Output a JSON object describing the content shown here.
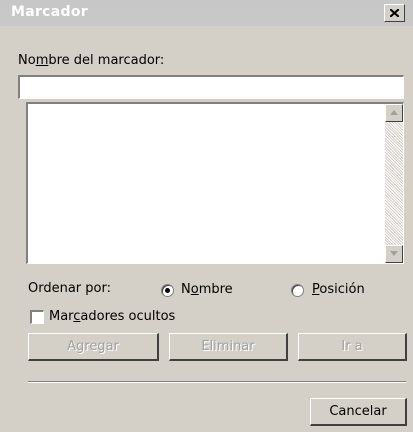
{
  "window": {
    "title": "Marcador"
  },
  "name_field": {
    "label": "Nombre del marcador:",
    "value": ""
  },
  "bookmarks_list": {
    "items": []
  },
  "sort": {
    "label": "Ordenar por:",
    "options": [
      {
        "label": "Nombre",
        "selected": true
      },
      {
        "label": "Posición",
        "selected": false
      }
    ]
  },
  "hidden_bookmarks": {
    "label": "Marcadores ocultos",
    "checked": false
  },
  "buttons": {
    "add": "Agregar",
    "delete": "Eliminar",
    "goto": "Ir a",
    "cancel": "Cancelar"
  },
  "colors": {
    "titlebar": "#c8c8c8",
    "dialog_bg": "#d4d0c8",
    "disabled_text": "#a0a0a0"
  }
}
